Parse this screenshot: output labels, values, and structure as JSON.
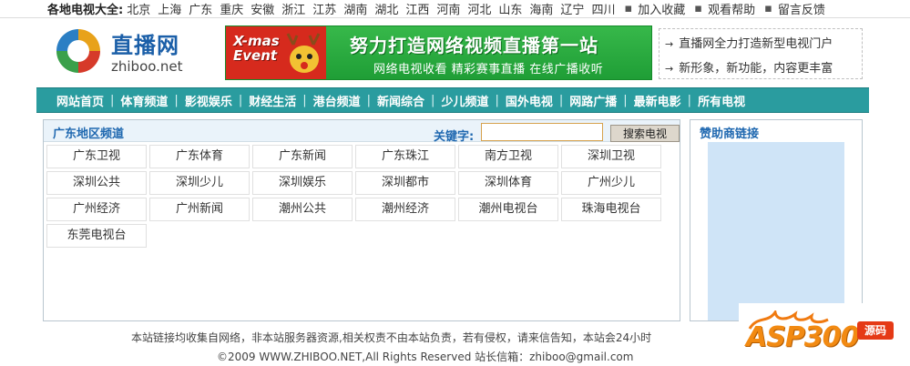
{
  "topbar": {
    "lead": "各地电视大全:",
    "regions": [
      "北京",
      "上海",
      "广东",
      "重庆",
      "安徽",
      "浙江",
      "江苏",
      "湖南",
      "湖北",
      "江西",
      "河南",
      "河北",
      "山东",
      "海南",
      "辽宁",
      "四川"
    ],
    "links": [
      "加入收藏",
      "观看帮助",
      "留言反馈"
    ]
  },
  "logo": {
    "cn": "直播网",
    "en": "zhiboo.net"
  },
  "banner": {
    "badge": "X-mas Event",
    "headline": "努力打造网络视频直播第一站",
    "tagline": "网络电视收看 精彩赛事直播 在线广播收听"
  },
  "notice": {
    "lines": [
      "直播网全力打造新型电视门户",
      "新形象，新功能，内容更丰富"
    ]
  },
  "nav": {
    "items": [
      "网站首页",
      "体育频道",
      "影视娱乐",
      "财经生活",
      "港台频道",
      "新闻综合",
      "少儿频道",
      "国外电视",
      "网路广播",
      "最新电影",
      "所有电视"
    ]
  },
  "main": {
    "title": "广东地区频道",
    "keyword_label": "关键字:",
    "keyword_value": "",
    "search_button": "搜索电视",
    "channels": [
      "广东卫视",
      "广东体育",
      "广东新闻",
      "广东珠江",
      "南方卫视",
      "深圳卫视",
      "深圳公共",
      "深圳少儿",
      "深圳娱乐",
      "深圳都市",
      "深圳体育",
      "广州少儿",
      "广州经济",
      "广州新闻",
      "潮州公共",
      "潮州经济",
      "潮州电视台",
      "珠海电视台",
      "东莞电视台"
    ]
  },
  "sponsor": {
    "title": "赞助商链接"
  },
  "footer": {
    "line1": "本站链接均收集自网络，非本站服务器资源,相关权责不由本站负责，若有侵权，请来信告知，本站会24小时",
    "line2": "©2009 WWW.ZHIBOO.NET,All Rights Reserved    站长信箱：zhiboo@gmail.com"
  },
  "watermark": {
    "word": "ASP300",
    "tag": "源码"
  },
  "colors": {
    "nav_bg": "#2a9c9f",
    "panel_title": "#1f68b0",
    "banner_green": "#1f9e36",
    "ad_blue": "#cfe4f7"
  }
}
